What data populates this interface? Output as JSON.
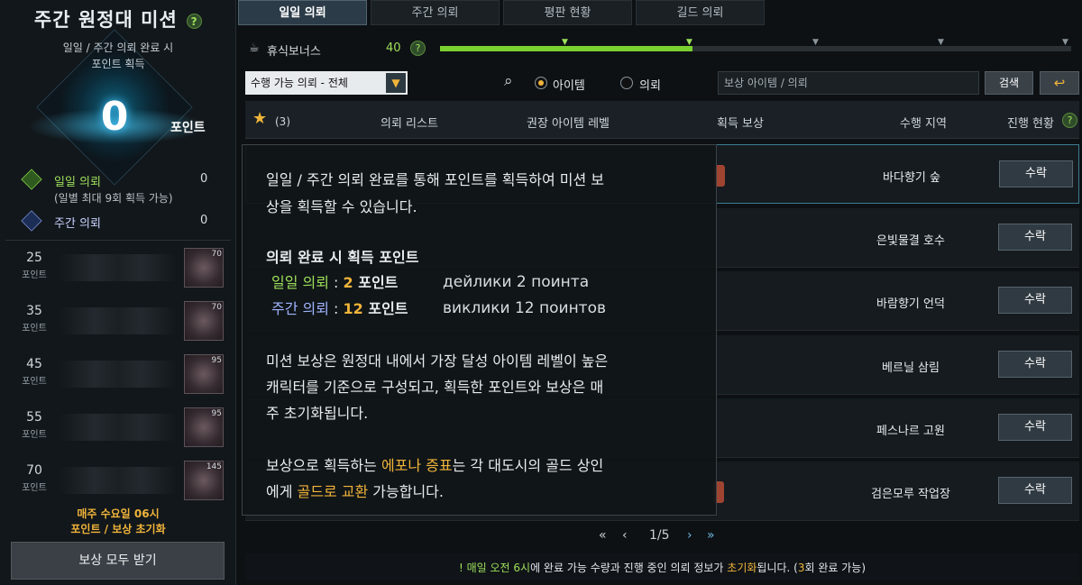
{
  "left": {
    "title": "주간 원정대 미션",
    "subtitle_line1": "일일 / 주간 의뢰 완료 시",
    "subtitle_line2": "포인트 획득",
    "points": "0",
    "points_label": "포인트",
    "daily_label": "일일 의뢰",
    "daily_value": "0",
    "daily_note": "(일별 최대 9회 획득 가능)",
    "weekly_label": "주간 의뢰",
    "weekly_value": "0",
    "tiers": [
      {
        "points": "25",
        "unit": "포인트",
        "level": "70"
      },
      {
        "points": "35",
        "unit": "포인트",
        "level": "70"
      },
      {
        "points": "45",
        "unit": "포인트",
        "level": "95"
      },
      {
        "points": "55",
        "unit": "포인트",
        "level": "95"
      },
      {
        "points": "70",
        "unit": "포인트",
        "level": "145"
      }
    ],
    "reset_line1": "매주 수요일 06시",
    "reset_line2": "포인트 / 보상 초기화",
    "claim_all": "보상 모두 받기"
  },
  "tabs": [
    "일일 의뢰",
    "주간 의뢰",
    "평판 현황",
    "길드 의뢰"
  ],
  "rest": {
    "label": "휴식보너스",
    "value": "40",
    "fill": 0.4
  },
  "filters": {
    "select_value": "수행 가능 의뢰 - 전체",
    "radio_item": "아이템",
    "radio_quest": "의뢰",
    "search_placeholder": "보상 아이템 / 의뢰",
    "search_button": "검색"
  },
  "table_header": {
    "fav_count": "(3)",
    "col_list": "의뢰 리스트",
    "col_level": "권장 아이템 레벨",
    "col_reward": "획득 보상",
    "col_region": "수행 지역",
    "col_progress": "진행 현황"
  },
  "rows": [
    {
      "region": "바다향기 숲",
      "button": "수락"
    },
    {
      "region": "은빛물결 호수",
      "button": "수락"
    },
    {
      "region": "바람향기 언덕",
      "button": "수락"
    },
    {
      "region": "베르닐 삼림",
      "button": "수락"
    },
    {
      "region": "페스나르 고원",
      "button": "수락"
    },
    {
      "region": "검은모루 작업장",
      "button": "수락"
    }
  ],
  "pager": {
    "text": "1/5"
  },
  "footer": {
    "p1": "매일 오전 6시",
    "p2": "에 완료 가능 수량과 진행 중인 의뢰 정보가 ",
    "p3": "초기화",
    "p4": "됩니다. (",
    "p5": "3",
    "p6": "회 완료 가능)"
  },
  "tooltip": {
    "para1_line1": "일일 / 주간 의뢰 완료를 통해 포인트를 획득하여 미션 보",
    "para1_line2": "상을 획득할 수 있습니다.",
    "heading": "의뢰 완료 시 획득 포인트",
    "daily_label": "일일 의뢰",
    "daily_sep": " : ",
    "daily_num": "2",
    "daily_unit": " 포인트",
    "daily_ru": "дейлики 2 поинта",
    "weekly_label": "주간 의뢰",
    "weekly_sep": " : ",
    "weekly_num": "12",
    "weekly_unit": " 포인트",
    "weekly_ru": "виклики 12 поинтов",
    "para2_line1": "미션 보상은 원정대 내에서 가장 달성 아이템 레벨이 높은",
    "para2_line2": "캐릭터를 기준으로 구성되고, 획득한 포인트와 보상은 매",
    "para2_line3": "주 초기화됩니다.",
    "para3_a": "보상으로 획득하는 ",
    "para3_b": "에포나 증표",
    "para3_c": "는 각 대도시의 골드 상인",
    "para3_d": "에게 ",
    "para3_e": "골드로 교환",
    "para3_f": " 가능합니다."
  },
  "colors": {
    "accent": "#f0b43a",
    "green": "#9ee05a",
    "cyan": "#41c4ff"
  }
}
